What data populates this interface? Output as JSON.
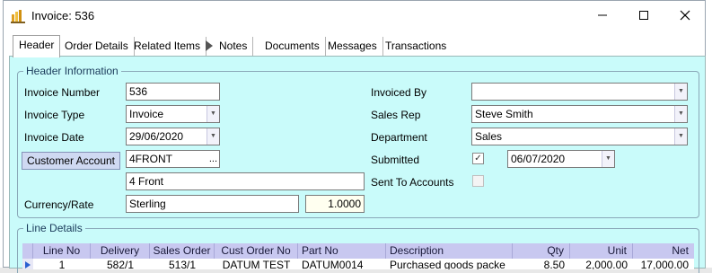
{
  "window": {
    "title": "Invoice: 536"
  },
  "tabs": [
    {
      "label": "Header"
    },
    {
      "label": "Order Details"
    },
    {
      "label": "Related Items"
    },
    {
      "label": "Notes"
    },
    {
      "label": "Documents"
    },
    {
      "label": "Messages"
    },
    {
      "label": "Transactions"
    }
  ],
  "header": {
    "group_label": "Header Information",
    "invoice_number_label": "Invoice Number",
    "invoice_number": "536",
    "invoice_type_label": "Invoice Type",
    "invoice_type": "Invoice",
    "invoice_date_label": "Invoice Date",
    "invoice_date": "29/06/2020",
    "customer_account_button": "Customer Account",
    "customer_account": "4FRONT",
    "customer_lookup": "...",
    "customer_name": "4 Front",
    "currency_label": "Currency/Rate",
    "currency": "Sterling",
    "rate": "1.0000",
    "invoiced_by_label": "Invoiced By",
    "invoiced_by": "",
    "sales_rep_label": "Sales Rep",
    "sales_rep": "Steve Smith",
    "department_label": "Department",
    "department": "Sales",
    "submitted_label": "Submitted",
    "submitted_checked": "✓",
    "submitted_date": "06/07/2020",
    "sent_to_accounts_label": "Sent To Accounts"
  },
  "lines": {
    "group_label": "Line Details",
    "columns": [
      "Line No",
      "Delivery",
      "Sales Order",
      "Cust Order No",
      "Part No",
      "Description",
      "Qty",
      "Unit",
      "Net"
    ],
    "rows": [
      [
        "1",
        "582/1",
        "513/1",
        "DATUM TEST",
        "DATUM0014",
        "Purchased goods packe",
        "8.50",
        "2,000.00",
        "17,000.00"
      ]
    ]
  },
  "colors": {
    "panel": "#c9fbfa",
    "grid_header": "#c8c8f0",
    "button": "#cfd9f2"
  },
  "icons": [
    "app-icon",
    "minimize-icon",
    "maximize-icon",
    "close-icon",
    "tab-scroll-arrow-icon",
    "dropdown-arrow-icon",
    "row-selector-arrow-icon"
  ]
}
